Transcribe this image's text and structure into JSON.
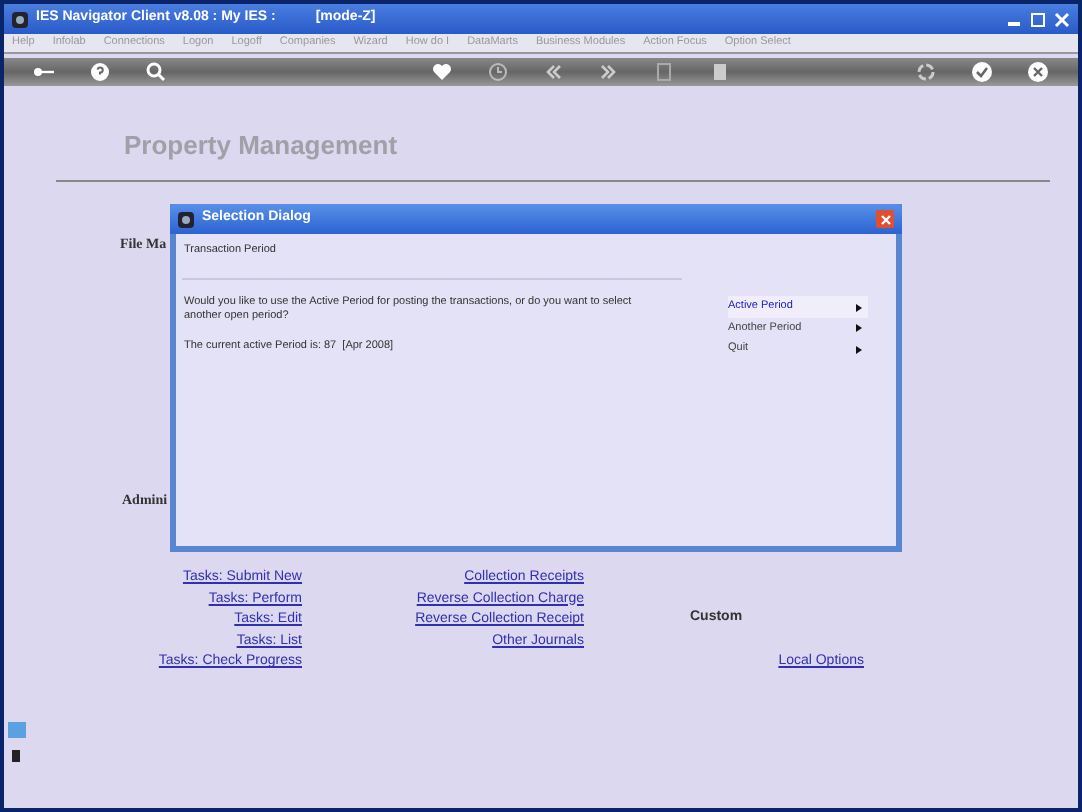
{
  "window": {
    "title": "IES Navigator Client v8.08 : My IES :",
    "mode": "[mode-Z]"
  },
  "menu": [
    "Help",
    "Infolab",
    "Connections",
    "Logon",
    "Logoff",
    "Companies",
    "Wizard",
    "How do I",
    "DataMarts",
    "Business Modules",
    "Action Focus",
    "Option Select"
  ],
  "page": {
    "title": "Property Management",
    "sections": [
      {
        "label": "File Ma"
      },
      {
        "label": "Admini"
      }
    ],
    "link_columns": [
      {
        "links": [
          "Tasks: Submit New",
          "Tasks: Perform",
          "Tasks: Edit",
          "Tasks: List",
          "Tasks: Check Progress"
        ]
      },
      {
        "links": [
          "Collection Receipts",
          "Reverse Collection Charge",
          "Reverse Collection Receipt",
          "Other Journals"
        ]
      },
      {
        "heading": "Custom",
        "links": [
          "Local Options"
        ]
      }
    ]
  },
  "dialog": {
    "title": "Selection Dialog",
    "subtitle": "Transaction Period",
    "question": "Would you like to use the Active Period for posting the transactions, or do you want to select another open period?",
    "current": "The current active Period is: 87  [Apr 2008]",
    "options": [
      {
        "label": "Active Period",
        "selected": true
      },
      {
        "label": "Another Period",
        "selected": false
      },
      {
        "label": "Quit",
        "selected": false
      }
    ]
  }
}
